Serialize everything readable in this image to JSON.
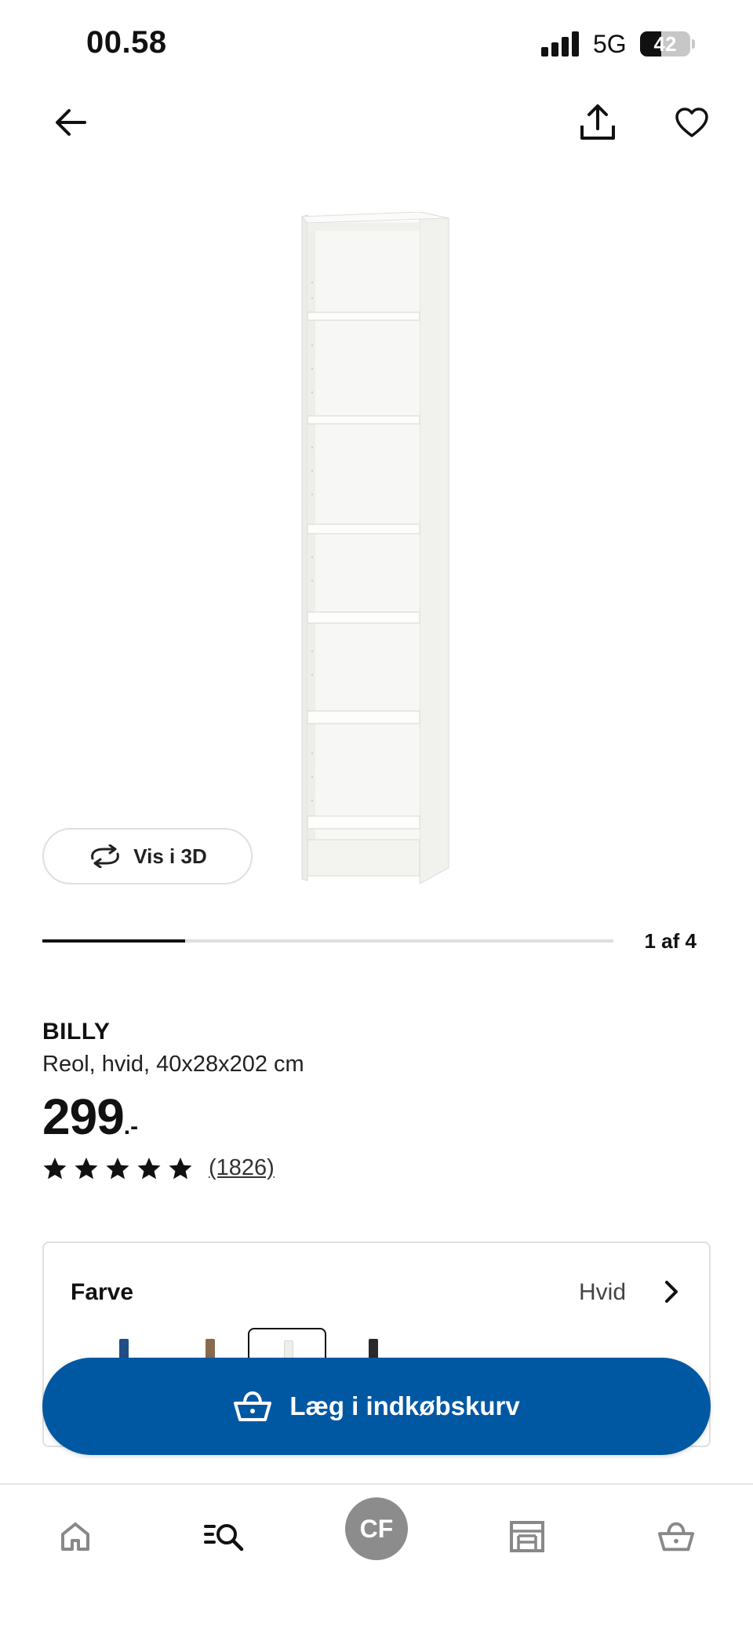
{
  "status_bar": {
    "time": "00.58",
    "network": "5G",
    "battery": "42",
    "battery_level": 0.42
  },
  "nav": {
    "back_icon": "arrow-left-icon",
    "share_icon": "share-icon",
    "favorite_icon": "heart-icon"
  },
  "gallery": {
    "vis3d_label": "Vis i 3D",
    "counter": "1 af 4",
    "current_image": 1,
    "total_images": 4
  },
  "product": {
    "name": "BILLY",
    "description": "Reol, hvid, 40x28x202 cm",
    "price": "299",
    "price_suffix": ".-",
    "rating": 5,
    "reviews": "(1826)"
  },
  "color_selector": {
    "label": "Farve",
    "value": "Hvid",
    "swatches": [
      {
        "name": "blue",
        "color": "#1f4f86",
        "selected": false
      },
      {
        "name": "brown",
        "color": "#8a6a4f",
        "selected": false
      },
      {
        "name": "white",
        "color": "#efefe9",
        "selected": true
      },
      {
        "name": "black",
        "color": "#2a2a2a",
        "selected": false
      }
    ]
  },
  "add_to_cart": {
    "label": "Læg i indkøbskurv",
    "icon": "basket-icon"
  },
  "bottom_nav": {
    "items": [
      "home-icon",
      "search-list-icon",
      "profile-avatar",
      "store-icon",
      "basket-icon"
    ],
    "avatar_initials": "CF"
  },
  "colors": {
    "brand_blue": "#0058a3",
    "text": "#111111",
    "border": "#dfdfdf"
  }
}
